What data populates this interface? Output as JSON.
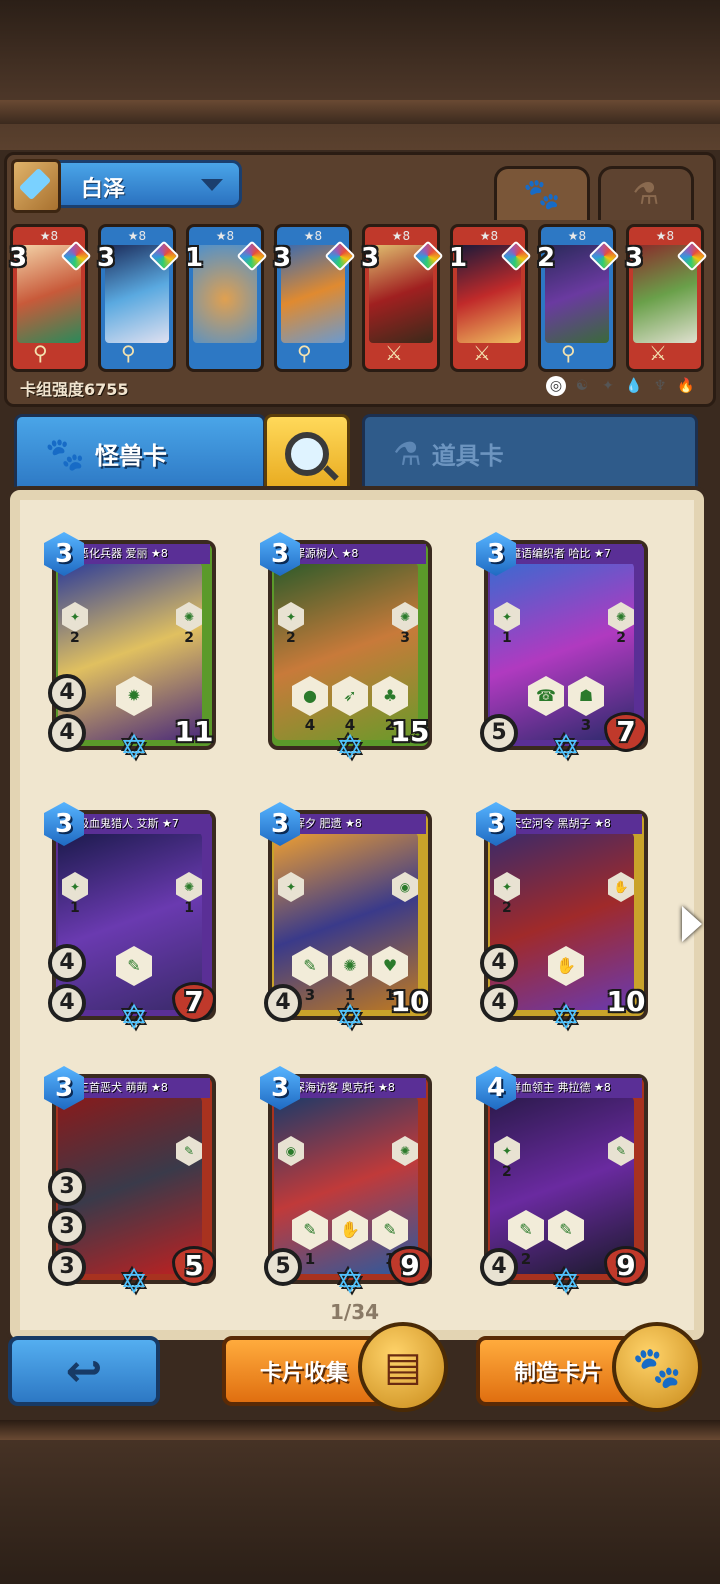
{
  "deck": {
    "name": "白泽",
    "power_label": "卡组强度6755"
  },
  "top_tabs": {
    "monster_icon": "paw-icon",
    "item_icon": "potion-icon"
  },
  "mini_cards": [
    {
      "stars": "★8",
      "count": "3",
      "color": "#c0392b"
    },
    {
      "stars": "★8",
      "count": "3",
      "color": "#2d78c4"
    },
    {
      "stars": "★8",
      "count": "1",
      "color": "#2d78c4"
    },
    {
      "stars": "★8",
      "count": "3",
      "color": "#2d78c4"
    },
    {
      "stars": "★8",
      "count": "3",
      "color": "#c0392b"
    },
    {
      "stars": "★8",
      "count": "1",
      "color": "#c0392b"
    },
    {
      "stars": "★8",
      "count": "2",
      "color": "#2d78c4"
    },
    {
      "stars": "★8",
      "count": "3",
      "color": "#c0392b"
    }
  ],
  "categories": {
    "monster": "怪兽卡",
    "item": "道具卡"
  },
  "cards": [
    {
      "mana": "3",
      "title": "恶化兵器 爱丽 ★8",
      "atk": "4",
      "def": "4",
      "hp": "11",
      "abilities": [
        ""
      ],
      "left": "2",
      "right": "2"
    },
    {
      "mana": "3",
      "title": "罪源树人 ★8",
      "atk": "",
      "def": "",
      "hp": "15",
      "abilities": [
        "4",
        "4",
        "2"
      ],
      "left": "2",
      "right": "3"
    },
    {
      "mana": "3",
      "title": "魔语编织者 哈比 ★7",
      "atk": "",
      "def": "5",
      "hp": "7",
      "abilities": [
        "",
        "3"
      ],
      "left": "1",
      "right": "2"
    },
    {
      "mana": "3",
      "title": "吸血鬼猎人 艾斯 ★7",
      "atk": "4",
      "def": "4",
      "hp": "7",
      "abilities": [
        ""
      ],
      "left": "1",
      "right": "1"
    },
    {
      "mana": "3",
      "title": "浑夕 肥遗 ★8",
      "atk": "",
      "def": "4",
      "hp": "10",
      "abilities": [
        "3",
        "1",
        "1"
      ],
      "left": "",
      "right": ""
    },
    {
      "mana": "3",
      "title": "天空河令 黑胡子 ★8",
      "atk": "4",
      "def": "4",
      "hp": "10",
      "abilities": [
        ""
      ],
      "left": "2",
      "right": ""
    },
    {
      "mana": "3",
      "title": "三首恶犬 萌萌 ★8",
      "atk": "3",
      "def": "3",
      "hp": "5",
      "extra": "3",
      "abilities": [],
      "left": "",
      "right": ""
    },
    {
      "mana": "3",
      "title": "深海访客 奥克托 ★8",
      "atk": "",
      "def": "5",
      "hp": "9",
      "abilities": [
        "1",
        "",
        "1"
      ],
      "left": "",
      "right": ""
    },
    {
      "mana": "4",
      "title": "鲜血领主 弗拉德 ★8",
      "atk": "",
      "def": "4",
      "hp": "9",
      "abilities": [
        "2",
        ""
      ],
      "left": "2",
      "right": ""
    }
  ],
  "pager": "1/34",
  "buttons": {
    "collect": "卡片收集",
    "craft": "制造卡片"
  }
}
